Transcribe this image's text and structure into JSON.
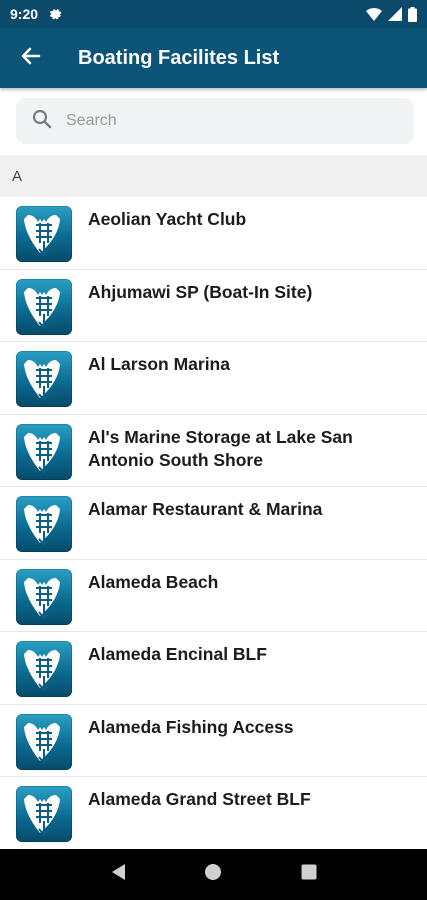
{
  "status_bar": {
    "time": "9:20",
    "icons": [
      "gear-icon",
      "wifi-icon",
      "signal-icon",
      "battery-icon"
    ]
  },
  "app_bar": {
    "back_icon": "arrow-left-icon",
    "title": "Boating Facilites List"
  },
  "search": {
    "placeholder": "Search",
    "value": "",
    "icon": "search-icon"
  },
  "section": {
    "letter": "A"
  },
  "facilities": [
    {
      "name": "Aeolian Yacht Club"
    },
    {
      "name": "Ahjumawi SP (Boat-In Site)"
    },
    {
      "name": "Al Larson Marina"
    },
    {
      "name": "Al's Marine Storage at Lake San Antonio South Shore"
    },
    {
      "name": "Alamar Restaurant & Marina"
    },
    {
      "name": "Alameda Beach"
    },
    {
      "name": "Alameda Encinal BLF"
    },
    {
      "name": "Alameda Fishing Access"
    },
    {
      "name": "Alameda Grand Street BLF"
    }
  ],
  "nav_bar": {
    "icons": [
      "back-triangle-icon",
      "home-circle-icon",
      "recents-square-icon"
    ]
  },
  "colors": {
    "status_bar": "#0b4a6b",
    "app_bar": "#0c5579",
    "logo_top": "#2aa0c4",
    "logo_bottom": "#064b69"
  }
}
